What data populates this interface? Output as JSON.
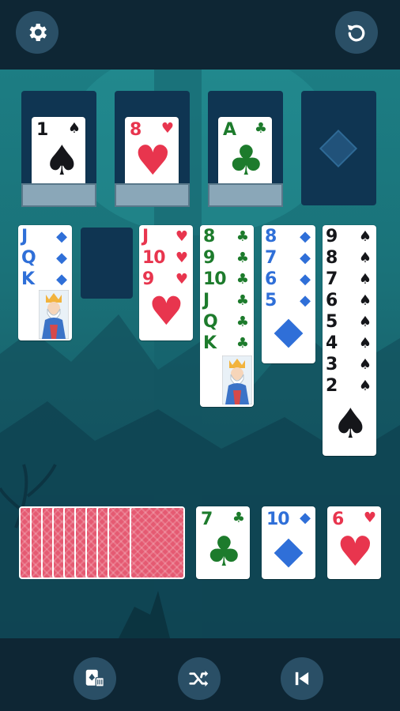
{
  "toolbar": {
    "settings_icon": "gear-icon",
    "undo_icon": "undo-icon",
    "bottom_icons": [
      "cards-delete-icon",
      "shuffle-icon",
      "skip-back-icon"
    ]
  },
  "colors": {
    "accent": "#2a4f66",
    "red_suit": "#e8354e",
    "club_green": "#1d7b2c",
    "diamond_blue": "#2f6fd8",
    "slot": "#0f3552"
  },
  "foundations": [
    {
      "rank": "1",
      "suit": "♠"
    },
    {
      "rank": "8",
      "suit": "♥"
    },
    {
      "rank": "A",
      "suit": "♣"
    },
    {
      "empty": true,
      "suit": "◆"
    }
  ],
  "columns": {
    "col1": {
      "ranks": [
        "J",
        "Q",
        "K"
      ],
      "suit": "◆"
    },
    "col3": {
      "ranks": [
        "J",
        "10",
        "9"
      ],
      "suit": "♥"
    },
    "col4": {
      "ranks": [
        "8",
        "9",
        "10",
        "J",
        "Q",
        "K"
      ],
      "suit": "♣"
    },
    "col5": {
      "ranks": [
        "8",
        "7",
        "6",
        "5"
      ],
      "suit": "◆"
    },
    "col6": {
      "ranks": [
        "9",
        "8",
        "7",
        "6",
        "5",
        "4",
        "3",
        "2"
      ],
      "suit": "♠"
    }
  },
  "waste": [
    {
      "rank": "7",
      "suit": "♣"
    },
    {
      "rank": "10",
      "suit": "◆"
    },
    {
      "rank": "6",
      "suit": "♥"
    }
  ]
}
